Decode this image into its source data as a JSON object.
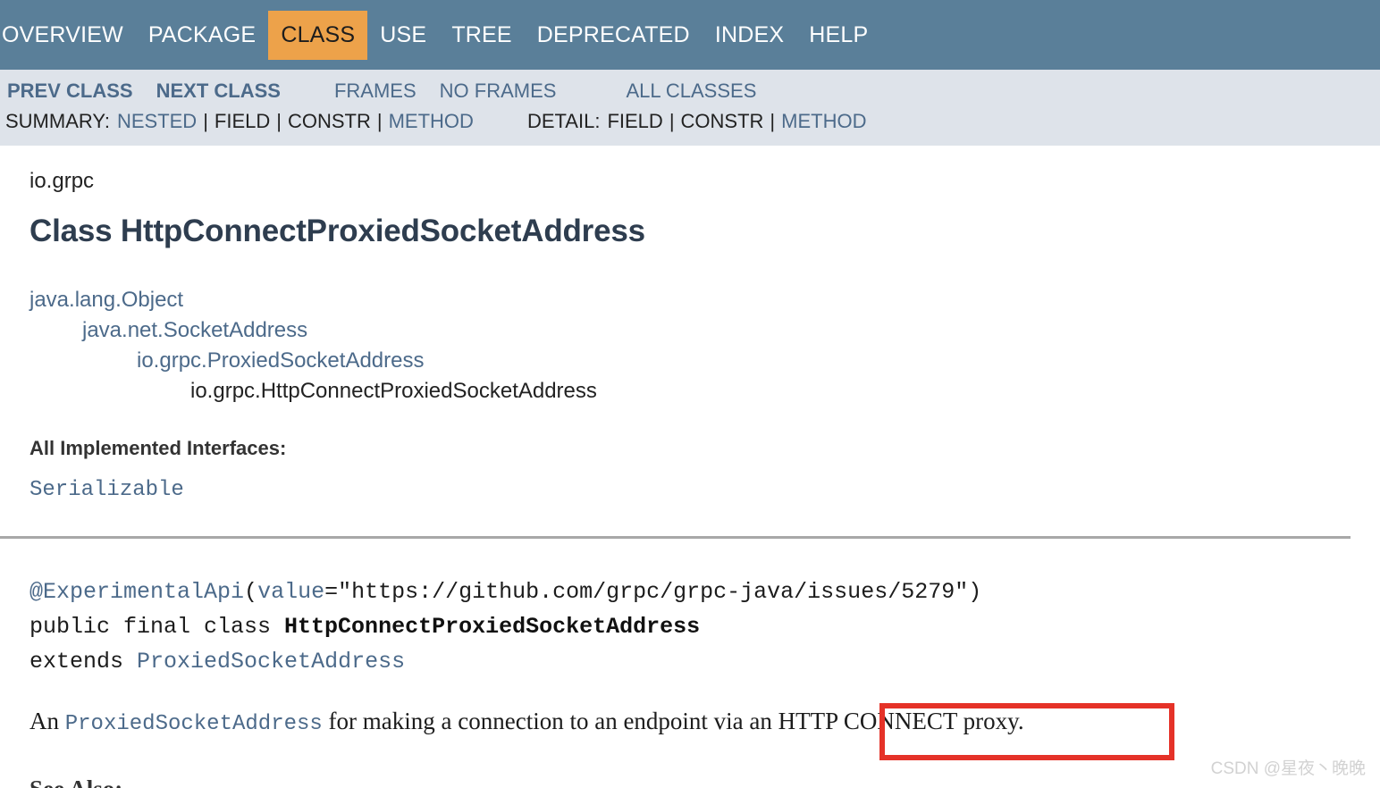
{
  "topnav": {
    "items": [
      {
        "label": "OVERVIEW",
        "active": false
      },
      {
        "label": "PACKAGE",
        "active": false
      },
      {
        "label": "CLASS",
        "active": true
      },
      {
        "label": "USE",
        "active": false
      },
      {
        "label": "TREE",
        "active": false
      },
      {
        "label": "DEPRECATED",
        "active": false
      },
      {
        "label": "INDEX",
        "active": false
      },
      {
        "label": "HELP",
        "active": false
      }
    ],
    "active_color": "#eda24a",
    "bar_color": "#5a7f99"
  },
  "subnav": {
    "prev_class": "PREV CLASS",
    "next_class": "NEXT CLASS",
    "frames": "FRAMES",
    "no_frames": "NO FRAMES",
    "all_classes": "ALL CLASSES",
    "summary_label": "SUMMARY:",
    "summary_nested": "NESTED",
    "summary_field": "FIELD",
    "summary_constr": "CONSTR",
    "summary_method": "METHOD",
    "detail_label": "DETAIL:",
    "detail_field": "FIELD",
    "detail_constr": "CONSTR",
    "detail_method": "METHOD",
    "separator": "|"
  },
  "main": {
    "package": "io.grpc",
    "title": "Class HttpConnectProxiedSocketAddress",
    "hierarchy": [
      "java.lang.Object",
      "java.net.SocketAddress",
      "io.grpc.ProxiedSocketAddress",
      "io.grpc.HttpConnectProxiedSocketAddress"
    ],
    "interfaces_label": "All Implemented Interfaces:",
    "interfaces": "Serializable",
    "declaration": {
      "annotation": "@ExperimentalApi",
      "paren_open": "(",
      "attr_name": "value",
      "equals": "=",
      "attr_value": "\"https://github.com/grpc/grpc-java/issues/5279\"",
      "paren_close": ")",
      "modifiers": "public final class ",
      "class_name": "HttpConnectProxiedSocketAddress",
      "extends_kw": "extends ",
      "superclass": "ProxiedSocketAddress"
    },
    "description": {
      "lead": "An ",
      "code_ref": "ProxiedSocketAddress",
      "mid": " for making a connection to an endpoint via an ",
      "highlighted": "HTTP CONNECT proxy."
    },
    "highlight_color": "#e53228"
  },
  "watermark": "CSDN @星夜丶晚晚"
}
